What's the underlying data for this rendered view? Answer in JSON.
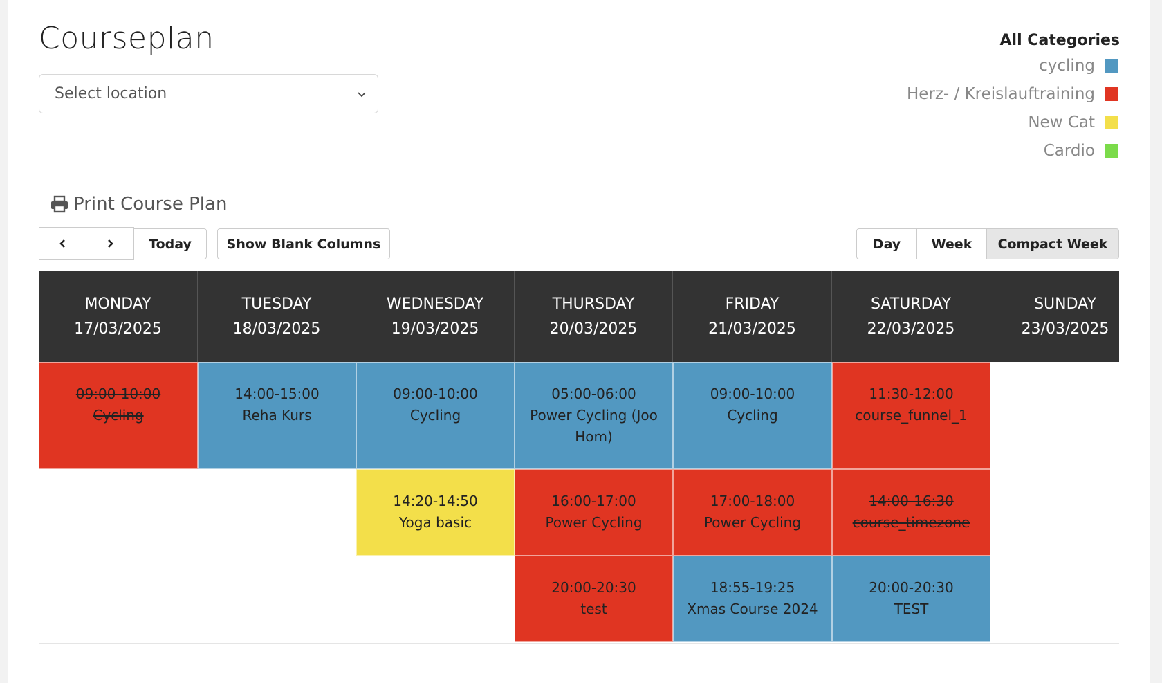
{
  "page_title": "Courseplan",
  "location_select": {
    "placeholder": "Select location"
  },
  "legend": {
    "title": "All Categories",
    "items": [
      {
        "label": "cycling",
        "color": "#5298c1"
      },
      {
        "label": "Herz- / Kreislauftraining",
        "color": "#e03522"
      },
      {
        "label": "New Cat",
        "color": "#f3df4a"
      },
      {
        "label": "Cardio",
        "color": "#7bdb4a"
      }
    ]
  },
  "print_label": "Print Course Plan",
  "toolbar": {
    "prev_icon": "chevron-left-icon",
    "next_icon": "chevron-right-icon",
    "today_label": "Today",
    "blank_columns_label": "Show Blank Columns",
    "views": [
      "Day",
      "Week",
      "Compact Week"
    ],
    "active_view": "Compact Week"
  },
  "days": [
    {
      "name": "MONDAY",
      "date": "17/03/2025"
    },
    {
      "name": "TUESDAY",
      "date": "18/03/2025"
    },
    {
      "name": "WEDNESDAY",
      "date": "19/03/2025"
    },
    {
      "name": "THURSDAY",
      "date": "20/03/2025"
    },
    {
      "name": "FRIDAY",
      "date": "21/03/2025"
    },
    {
      "name": "SATURDAY",
      "date": "22/03/2025"
    },
    {
      "name": "SUNDAY",
      "date": "23/03/2025"
    }
  ],
  "events": [
    {
      "time": "09:00-10:00",
      "name": "Cycling",
      "color": "#e03522",
      "cancelled": true
    },
    {
      "time": "14:00-15:00",
      "name": "Reha Kurs",
      "color": "#5298c1",
      "cancelled": false
    },
    {
      "time": "09:00-10:00",
      "name": "Cycling",
      "color": "#5298c1",
      "cancelled": false
    },
    {
      "time": "05:00-06:00",
      "name": "Power Cycling (Joo Hom)",
      "color": "#5298c1",
      "cancelled": false
    },
    {
      "time": "09:00-10:00",
      "name": "Cycling",
      "color": "#5298c1",
      "cancelled": false
    },
    {
      "time": "11:30-12:00",
      "name": "course_funnel_1",
      "color": "#e03522",
      "cancelled": false
    },
    {
      "time": "14:20-14:50",
      "name": "Yoga basic",
      "color": "#f3df4a",
      "cancelled": false
    },
    {
      "time": "16:00-17:00",
      "name": "Power Cycling",
      "color": "#e03522",
      "cancelled": false
    },
    {
      "time": "17:00-18:00",
      "name": "Power Cycling",
      "color": "#e03522",
      "cancelled": false
    },
    {
      "time": "14:00-16:30",
      "name": "course_timezone",
      "color": "#e03522",
      "cancelled": true
    },
    {
      "time": "20:00-20:30",
      "name": "test",
      "color": "#e03522",
      "cancelled": false
    },
    {
      "time": "18:55-19:25",
      "name": "Xmas Course 2024",
      "color": "#5298c1",
      "cancelled": false
    },
    {
      "time": "20:00-20:30",
      "name": "TEST",
      "color": "#5298c1",
      "cancelled": false
    }
  ]
}
